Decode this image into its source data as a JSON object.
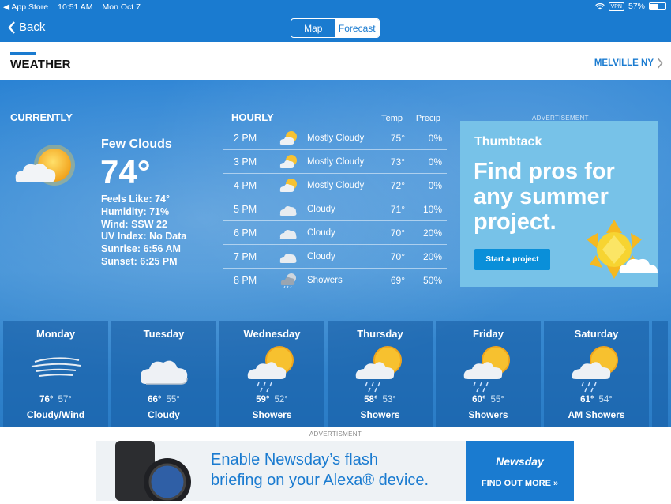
{
  "status_bar": {
    "back_app": "◀ App Store",
    "time": "10:51 AM",
    "date": "Mon Oct 7",
    "vpn": "VPN",
    "battery": "57%"
  },
  "nav": {
    "back_label": "Back",
    "segments": [
      "Map",
      "Forecast"
    ],
    "active_segment": "Forecast"
  },
  "header": {
    "title": "WEATHER",
    "location": "MELVILLE NY"
  },
  "currently": {
    "label": "CURRENTLY",
    "condition": "Few Clouds",
    "temperature": "74°",
    "feels_like": "Feels Like: 74°",
    "humidity": "Humidity: 71%",
    "wind": "Wind: SSW 22",
    "uv_index": "UV Index: No Data",
    "sunrise": "Sunrise: 6:56 AM",
    "sunset": "Sunset: 6:25 PM",
    "icon": "sun-cloud-icon"
  },
  "hourly": {
    "title": "HOURLY",
    "col_temp": "Temp",
    "col_precip": "Precip",
    "rows": [
      {
        "time": "2 PM",
        "icon": "partly-cloudy-icon",
        "desc": "Mostly Cloudy",
        "temp": "75°",
        "precip": "0%"
      },
      {
        "time": "3 PM",
        "icon": "partly-cloudy-icon",
        "desc": "Mostly Cloudy",
        "temp": "73°",
        "precip": "0%"
      },
      {
        "time": "4 PM",
        "icon": "partly-cloudy-icon",
        "desc": "Mostly Cloudy",
        "temp": "72°",
        "precip": "0%"
      },
      {
        "time": "5 PM",
        "icon": "cloud-icon",
        "desc": "Cloudy",
        "temp": "71°",
        "precip": "10%"
      },
      {
        "time": "6 PM",
        "icon": "cloud-icon",
        "desc": "Cloudy",
        "temp": "70°",
        "precip": "20%"
      },
      {
        "time": "7 PM",
        "icon": "cloud-icon",
        "desc": "Cloudy",
        "temp": "70°",
        "precip": "20%"
      },
      {
        "time": "8 PM",
        "icon": "moon-showers-icon",
        "desc": "Showers",
        "temp": "69°",
        "precip": "50%"
      }
    ]
  },
  "side_ad": {
    "label": "ADVERTISEMENT",
    "brand": "Thumbtack",
    "headline_1": "Find pros for",
    "headline_2": "any summer",
    "headline_3": "project.",
    "button": "Start a project"
  },
  "daily": [
    {
      "day": "Monday",
      "hi": "76°",
      "lo": "57°",
      "desc": "Cloudy/Wind",
      "icon": "wind-icon"
    },
    {
      "day": "Tuesday",
      "hi": "66°",
      "lo": "55°",
      "desc": "Cloudy",
      "icon": "cloud-icon"
    },
    {
      "day": "Wednesday",
      "hi": "59°",
      "lo": "52°",
      "desc": "Showers",
      "icon": "sun-showers-icon"
    },
    {
      "day": "Thursday",
      "hi": "58°",
      "lo": "53°",
      "desc": "Showers",
      "icon": "sun-showers-icon"
    },
    {
      "day": "Friday",
      "hi": "60°",
      "lo": "55°",
      "desc": "Showers",
      "icon": "sun-showers-icon"
    },
    {
      "day": "Saturday",
      "hi": "61°",
      "lo": "54°",
      "desc": "AM Showers",
      "icon": "sun-showers-icon"
    }
  ],
  "bottom_ad": {
    "label": "ADVERTISMENT",
    "line_1": "Enable Newsday’s flash",
    "line_2": "briefing on your Alexa® device.",
    "brand": "Newsday",
    "cta": "FIND OUT MORE »"
  },
  "colors": {
    "accent": "#1a7bd0",
    "ad_bg": "#77c2e8",
    "ad_button": "#0a8fd9"
  }
}
